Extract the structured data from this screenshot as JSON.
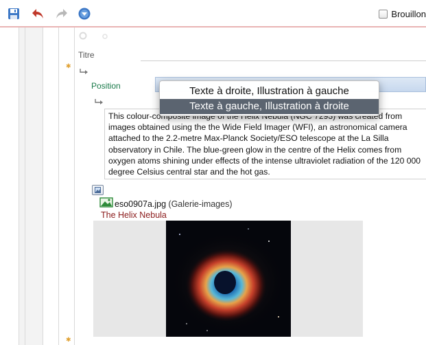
{
  "toolbar": {
    "save_icon": "save-icon",
    "undo_icon": "undo-icon",
    "redo_icon": "redo-icon",
    "publish_icon": "publish-icon",
    "draft_label": "Brouillon",
    "draft_checked": false
  },
  "form": {
    "title_label": "Titre",
    "position_label": "Position"
  },
  "position_menu": {
    "options": [
      "Texte à droite, Illustration à gauche",
      "Texte à gauche, Illustration à droite"
    ],
    "selected_index": 1
  },
  "text_block": {
    "body": "This colour-composite image of the Helix Nebula (NGC 7293) was created from images obtained using the the Wide Field Imager (WFI), an astronomical camera attached to the 2.2-metre Max-Planck Society/ESO telescope at the La Silla observatory in Chile. The blue-green glow in the centre of the Helix comes from oxygen atoms shining under effects of the intense ultraviolet radiation of the 120 000 degree Celsius central star and the hot gas."
  },
  "image_block": {
    "file_name": "eso0907a.jpg",
    "gallery": "(Galerie-images)",
    "caption": "The Helix Nebula"
  },
  "colors": {
    "accent_line": "#e9b4b4",
    "position_label": "#1a7a4a",
    "caption": "#8a1a1a",
    "menu_selected": "#5b6470"
  }
}
